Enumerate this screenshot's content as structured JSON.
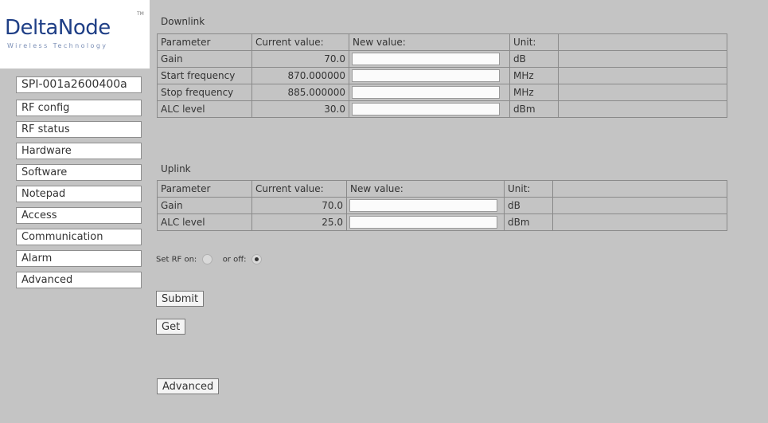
{
  "logo": {
    "brand": "DeltaNode",
    "tagline": "Wireless Technology",
    "tm": "TM"
  },
  "sidebar": {
    "items": [
      {
        "label": "SPI-001a2600400a"
      },
      {
        "label": "RF config"
      },
      {
        "label": "RF status"
      },
      {
        "label": "Hardware"
      },
      {
        "label": "Software"
      },
      {
        "label": "Notepad"
      },
      {
        "label": "Access"
      },
      {
        "label": "Communication"
      },
      {
        "label": "Alarm"
      },
      {
        "label": "Advanced"
      }
    ]
  },
  "downlink": {
    "title": "Downlink",
    "headers": {
      "parameter": "Parameter",
      "current": "Current value:",
      "new": "New value:",
      "unit": "Unit:"
    },
    "rows": [
      {
        "parameter": "Gain",
        "current": "70.0",
        "unit": "dB",
        "new_value": ""
      },
      {
        "parameter": "Start frequency",
        "current": "870.000000",
        "unit": "MHz",
        "new_value": ""
      },
      {
        "parameter": "Stop frequency",
        "current": "885.000000",
        "unit": "MHz",
        "new_value": ""
      },
      {
        "parameter": "ALC level",
        "current": "30.0",
        "unit": "dBm",
        "new_value": ""
      }
    ]
  },
  "uplink": {
    "title": "Uplink",
    "headers": {
      "parameter": "Parameter",
      "current": "Current value:",
      "new": "New value:",
      "unit": "Unit:"
    },
    "rows": [
      {
        "parameter": "Gain",
        "current": "70.0",
        "unit": "dB",
        "new_value": ""
      },
      {
        "parameter": "ALC level",
        "current": "25.0",
        "unit": "dBm",
        "new_value": ""
      }
    ]
  },
  "rf_toggle": {
    "on_label": "Set RF on:",
    "off_label": "or off:",
    "selected": "off"
  },
  "buttons": {
    "submit": "Submit",
    "get": "Get",
    "advanced": "Advanced"
  }
}
